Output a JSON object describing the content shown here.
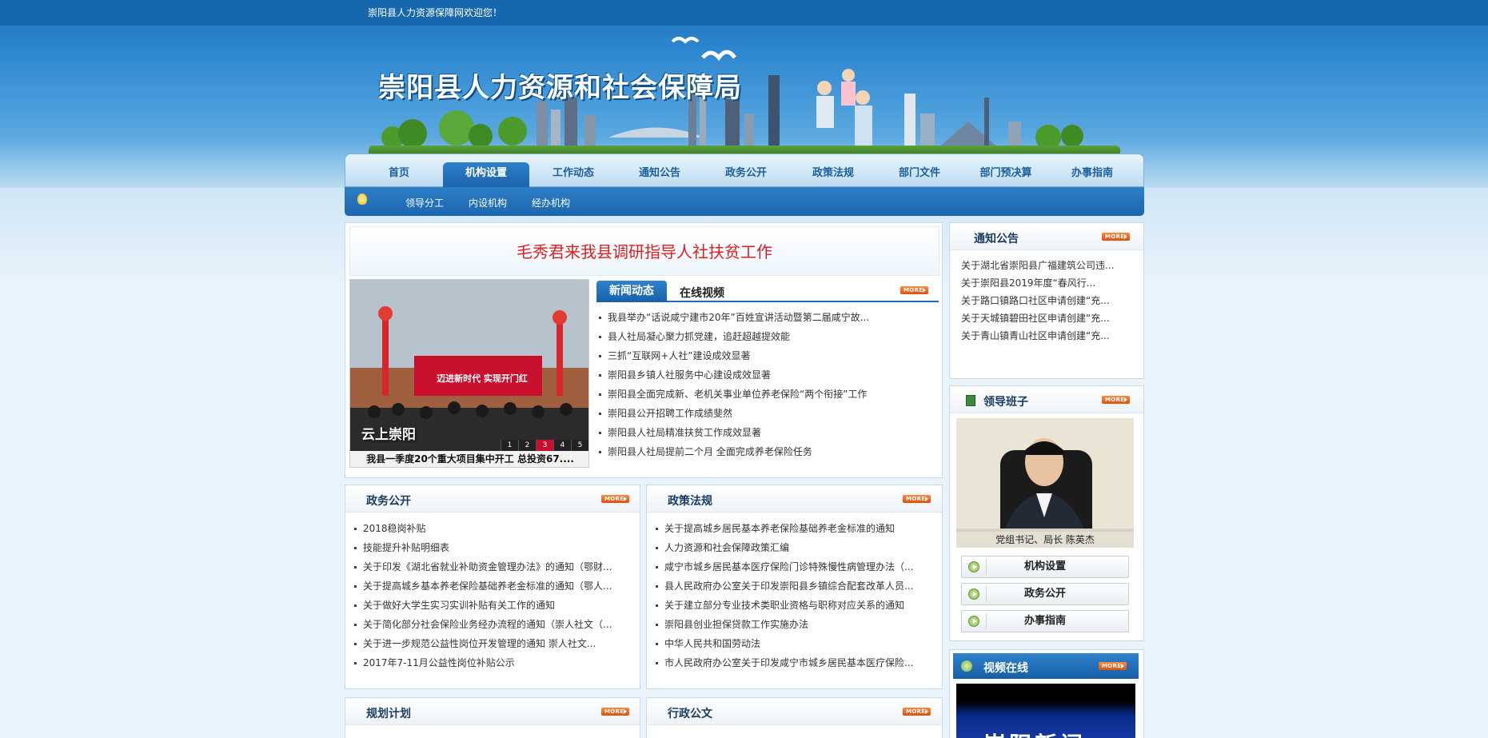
{
  "topbar": {
    "welcome": "崇阳县人力资源保障网欢迎您！"
  },
  "banner": {
    "title": "崇阳县人力资源和社会保障局"
  },
  "nav": {
    "items": [
      "首页",
      "机构设置",
      "工作动态",
      "通知公告",
      "政务公开",
      "政策法规",
      "部门文件",
      "部门预决算",
      "办事指南"
    ],
    "active_index": 1,
    "sub_items": [
      "领导分工",
      "内设机构",
      "经办机构"
    ]
  },
  "main": {
    "headline": "毛秀君来我县调研指导人社扶贫工作",
    "slideshow": {
      "caption": "我县一季度20个重大项目集中开工 总投资67....",
      "pages": [
        "1",
        "2",
        "3",
        "4",
        "5"
      ],
      "active_page": 3,
      "logo_text": "云上崇阳",
      "banner_text": "迈进新时代 实现开门红"
    },
    "tabs": {
      "active": "新闻动态",
      "other": "在线视频",
      "more": "MORE"
    },
    "news": [
      "我县举办“话说咸宁建市20年”百姓宣讲活动暨第二届咸宁故...",
      "县人社局凝心聚力抓党建，追赶超越提效能",
      "三抓“互联网+人社”建设成效显著",
      "崇阳县乡镇人社服务中心建设成效显著",
      "崇阳县全面完成新、老机关事业单位养老保险“两个衔接”工作",
      "崇阳县公开招聘工作成绩斐然",
      "崇阳县人社局精准扶贫工作成效显著",
      "崇阳县人社局提前二个月 全面完成养老保险任务"
    ]
  },
  "gov_open": {
    "title": "政务公开",
    "more": "MORE",
    "items": [
      "2018稳岗补贴",
      "技能提升补贴明细表",
      "关于印发《湖北省就业补助资金管理办法》的通知（鄂财...",
      "关于提高城乡基本养老保险基础养老金标准的通知（鄂人...",
      "关于做好大学生实习实训补贴有关工作的通知",
      "关于简化部分社会保险业务经办流程的通知（崇人社文（...",
      "关于进一步规范公益性岗位开发管理的通知 崇人社文...",
      "2017年7-11月公益性岗位补贴公示"
    ]
  },
  "policy": {
    "title": "政策法规",
    "more": "MORE",
    "items": [
      "关于提高城乡居民基本养老保险基础养老金标准的通知",
      "人力资源和社会保障政策汇编",
      "咸宁市城乡居民基本医疗保险门诊特殊慢性病管理办法（...",
      "县人民政府办公室关于印发崇阳县乡镇综合配套改革人员...",
      "关于建立部分专业技术类职业资格与职称对应关系的通知",
      "崇阳县创业担保贷款工作实施办法",
      "中华人民共和国劳动法",
      "市人民政府办公室关于印发咸宁市城乡居民基本医疗保险..."
    ]
  },
  "planning": {
    "title": "规划计划",
    "more": "MORE"
  },
  "admin_docs": {
    "title": "行政公文",
    "more": "MORE"
  },
  "notices": {
    "title": "通知公告",
    "more": "MORE",
    "items": [
      "关于湖北省崇阳县广福建筑公司违...",
      "关于崇阳县2019年度“春风行...",
      "关于路口镇路口社区申请创建“充...",
      "关于天城镇碧田社区申请创建“充...",
      "关于青山镇青山社区申请创建“充..."
    ]
  },
  "leaders": {
    "title": "领导班子",
    "more": "MORE",
    "caption": "党组书记、局长    陈英杰",
    "buttons": [
      "机构设置",
      "政务公开",
      "办事指南"
    ]
  },
  "video": {
    "title": "视频在线",
    "more": "MORE",
    "screen_text": "崇阳新闻"
  },
  "colors": {
    "brand_blue": "#1c66b0",
    "headline_red": "#e02020",
    "more_orange": "#e04e0b"
  }
}
